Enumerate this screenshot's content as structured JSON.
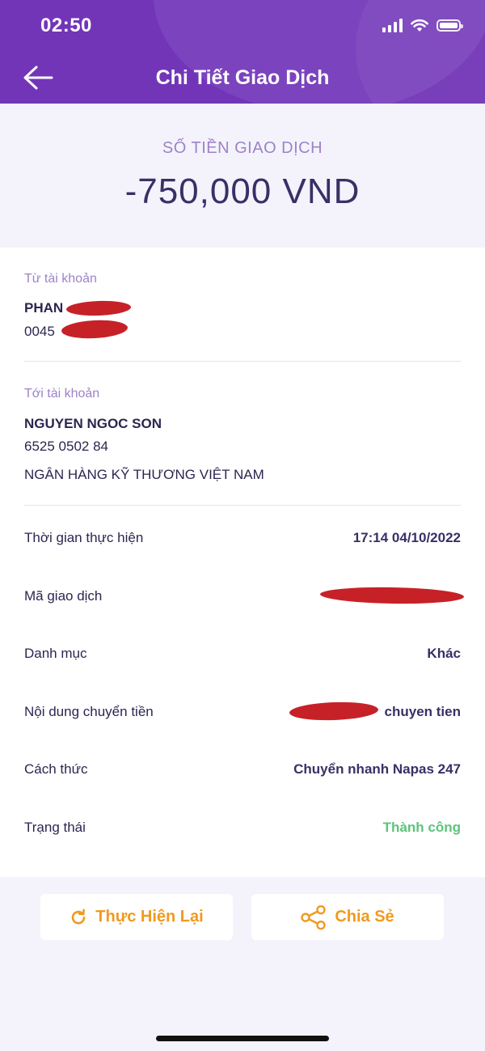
{
  "status_bar": {
    "time": "02:50"
  },
  "header": {
    "title": "Chi Tiết Giao Dịch"
  },
  "amount": {
    "label": "SỐ TIỀN GIAO DỊCH",
    "value": "-750,000 VND"
  },
  "from_account": {
    "label": "Từ tài khoản",
    "name": "PHAN",
    "number": "0045"
  },
  "to_account": {
    "label": "Tới tài khoản",
    "name": "NGUYEN NGOC SON",
    "number": "6525 0502 84",
    "bank": "NGÂN HÀNG KỸ THƯƠNG VIỆT NAM"
  },
  "details": [
    {
      "label": "Thời gian thực hiện",
      "value": "17:14 04/10/2022"
    },
    {
      "label": "Mã giao dịch",
      "value": ""
    },
    {
      "label": "Danh mục",
      "value": "Khác"
    },
    {
      "label": "Nội dung chuyển tiền",
      "value": "chuyen tien"
    },
    {
      "label": "Cách thức",
      "value": "Chuyển nhanh Napas 247"
    },
    {
      "label": "Trạng thái",
      "value": "Thành công",
      "status_color": "#5cc47b"
    }
  ],
  "actions": {
    "retry_label": "Thực Hiện Lại",
    "share_label": "Chia Sẻ"
  },
  "colors": {
    "header": "#7235b8",
    "accent": "#f09a1e",
    "label_purple": "#9d83c8",
    "redaction": "#c4151c"
  }
}
